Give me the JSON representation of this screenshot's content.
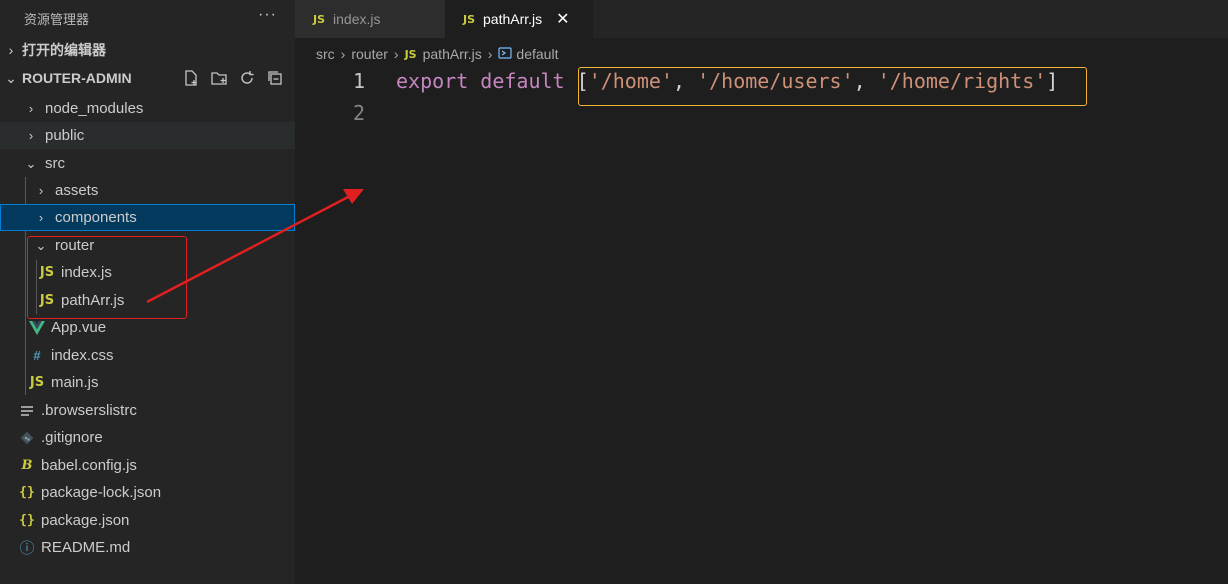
{
  "sidebar": {
    "header_title": "资源管理器",
    "more_label": "···",
    "open_editors_label": "打开的编辑器",
    "project_label": "ROUTER-ADMIN",
    "tree": [
      {
        "label": "node_modules",
        "type": "folder",
        "state": "collapsed"
      },
      {
        "label": "public",
        "type": "folder",
        "state": "collapsed"
      },
      {
        "label": "src",
        "type": "folder",
        "state": "expanded"
      },
      {
        "label": "assets",
        "type": "folder",
        "state": "collapsed"
      },
      {
        "label": "components",
        "type": "folder",
        "state": "collapsed",
        "selected": true
      },
      {
        "label": "router",
        "type": "folder",
        "state": "expanded"
      },
      {
        "label": "index.js",
        "type": "js"
      },
      {
        "label": "pathArr.js",
        "type": "js"
      },
      {
        "label": "App.vue",
        "type": "vue"
      },
      {
        "label": "index.css",
        "type": "css"
      },
      {
        "label": "main.js",
        "type": "js"
      },
      {
        "label": ".browserslistrc",
        "type": "config"
      },
      {
        "label": ".gitignore",
        "type": "git"
      },
      {
        "label": "babel.config.js",
        "type": "babel"
      },
      {
        "label": "package-lock.json",
        "type": "json"
      },
      {
        "label": "package.json",
        "type": "json"
      },
      {
        "label": "README.md",
        "type": "info"
      }
    ]
  },
  "tabs": [
    {
      "label": "index.js",
      "icon": "JS",
      "active": false
    },
    {
      "label": "pathArr.js",
      "icon": "JS",
      "active": true,
      "close": "✕"
    }
  ],
  "breadcrumb": {
    "items": [
      "src",
      "router",
      "pathArr.js",
      "default"
    ],
    "js_icon": "JS"
  },
  "editor": {
    "line_numbers": [
      "1",
      "2"
    ],
    "line1": {
      "kw1": "export",
      "kw2": "default",
      "open": "[",
      "s1": "'/home'",
      "comma": ",",
      "s2": "'/home/users'",
      "s3": "'/home/rights'",
      "close": "]"
    }
  },
  "icons": {
    "js": "JS",
    "hash": "#",
    "braces": "{}",
    "babel": "B",
    "info": "ⓘ"
  },
  "colors": {
    "selected_row": "#04395e",
    "highlight_box": "#f2b535",
    "annotation_red": "#e02020",
    "keyword": "#c586c0",
    "string": "#ce9178"
  }
}
